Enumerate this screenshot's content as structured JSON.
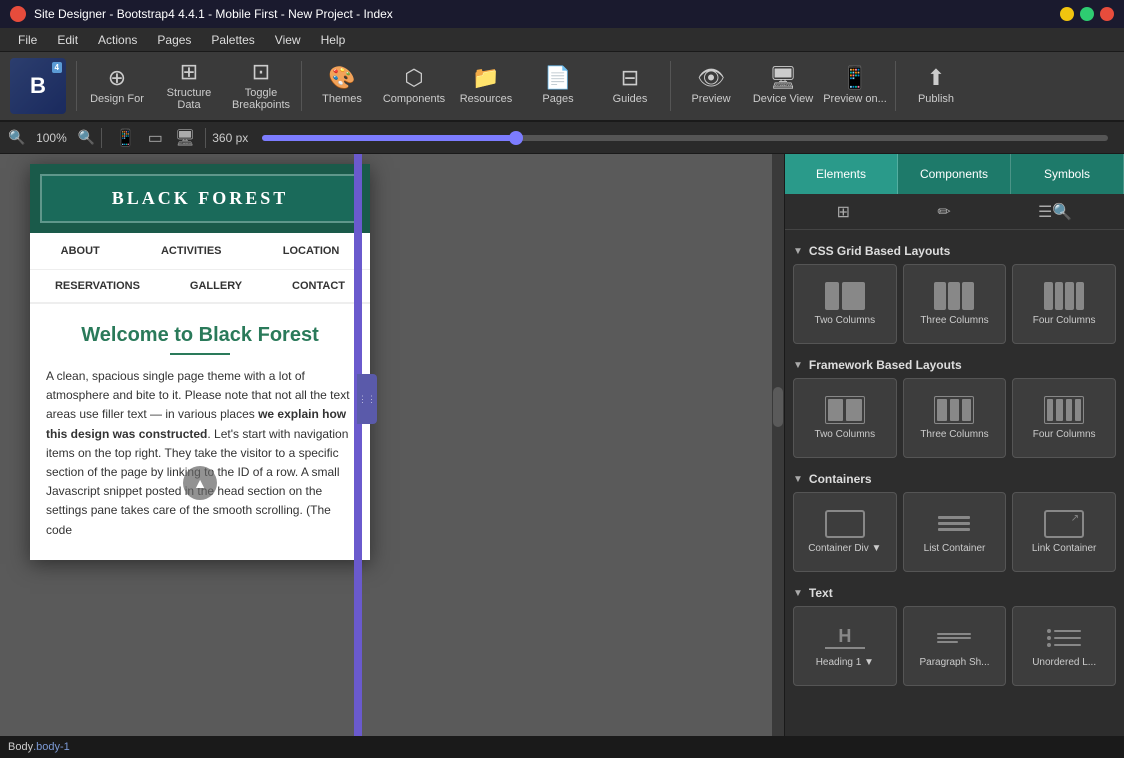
{
  "titleBar": {
    "title": "Site Designer - Bootstrap4 4.4.1 - Mobile First - New Project - Index",
    "appIcon": "sd-icon"
  },
  "menuBar": {
    "items": [
      "File",
      "Edit",
      "Actions",
      "Pages",
      "Palettes",
      "View",
      "Help"
    ]
  },
  "toolbar": {
    "logo": "B",
    "versionBadge": "4",
    "buttons": [
      {
        "id": "design-for",
        "icon": "⊕",
        "label": "Design For"
      },
      {
        "id": "structure-data",
        "icon": "⊞",
        "label": "Structure Data"
      },
      {
        "id": "toggle-breakpoints",
        "icon": "⊡",
        "label": "Toggle Breakpoints"
      },
      {
        "id": "themes",
        "icon": "🖌",
        "label": "Themes"
      },
      {
        "id": "components",
        "icon": "⬡",
        "label": "Components"
      },
      {
        "id": "resources",
        "icon": "📁",
        "label": "Resources"
      },
      {
        "id": "pages",
        "icon": "📄",
        "label": "Pages"
      },
      {
        "id": "guides",
        "icon": "⊟",
        "label": "Guides"
      },
      {
        "id": "preview",
        "icon": "👁",
        "label": "Preview"
      },
      {
        "id": "device-view",
        "icon": "🖥",
        "label": "Device View"
      },
      {
        "id": "preview-on",
        "icon": "📱",
        "label": "Preview on..."
      },
      {
        "id": "publish",
        "icon": "⬆",
        "label": "Publish"
      }
    ]
  },
  "zoomBar": {
    "zoomPercent": "100%",
    "widthPx": "360 px",
    "sliderPosition": 30,
    "devices": [
      "mobile",
      "tablet",
      "desktop"
    ]
  },
  "canvas": {
    "preview": {
      "logoText": "BLACK FOREST",
      "nav1": [
        "ABOUT",
        "ACTIVITIES",
        "LOCATION"
      ],
      "nav2": [
        "RESERVATIONS",
        "GALLERY",
        "CONTACT"
      ],
      "heading": "Welcome to Black Forest",
      "bodyText": "A clean, spacious single page theme with a lot of atmosphere and bite to it. Please note that not all the text areas use filler text — in various places we explain how this design was constructed. Let's start with navigation items on the top right. They take the visitor to a specific section of the page by linking to the ID of a row. A small Javascript snippet posted in the head section on the settings pane takes care of the smooth scrolling. (The code"
    }
  },
  "rightPanel": {
    "tabs": [
      {
        "id": "elements",
        "label": "Elements",
        "active": true
      },
      {
        "id": "components",
        "label": "Components",
        "active": false
      },
      {
        "id": "symbols",
        "label": "Symbols",
        "active": false
      }
    ],
    "tabIcons": [
      "grid-icon",
      "pencil-icon",
      "search-icon"
    ],
    "sections": [
      {
        "id": "css-grid",
        "label": "CSS Grid Based Layouts",
        "items": [
          {
            "id": "two-columns-css",
            "label": "Two Columns",
            "type": "two-col"
          },
          {
            "id": "three-columns-css",
            "label": "Three Columns",
            "type": "three-col"
          },
          {
            "id": "four-columns-css",
            "label": "Four Columns",
            "type": "four-col"
          }
        ]
      },
      {
        "id": "framework",
        "label": "Framework Based Layouts",
        "items": [
          {
            "id": "two-columns-fw",
            "label": "Two Columns",
            "type": "fw-two-col"
          },
          {
            "id": "three-columns-fw",
            "label": "Three Columns",
            "type": "fw-three-col"
          },
          {
            "id": "four-columns-fw",
            "label": "Four Columns",
            "type": "fw-four-col"
          }
        ]
      },
      {
        "id": "containers",
        "label": "Containers",
        "items": [
          {
            "id": "container-div",
            "label": "Container Div ▼",
            "type": "container"
          },
          {
            "id": "list-container",
            "label": "List Container",
            "type": "list"
          },
          {
            "id": "link-container",
            "label": "Link Container",
            "type": "link"
          }
        ]
      },
      {
        "id": "text",
        "label": "Text",
        "items": [
          {
            "id": "heading-1",
            "label": "Heading 1 ▼",
            "type": "heading"
          },
          {
            "id": "paragraph-sh",
            "label": "Paragraph Sh...",
            "type": "para"
          },
          {
            "id": "unordered-l",
            "label": "Unordered L...",
            "type": "unordered"
          }
        ]
      }
    ]
  },
  "statusBar": {
    "bodyLabel": "Body",
    "bodyClass": ".body-1"
  }
}
